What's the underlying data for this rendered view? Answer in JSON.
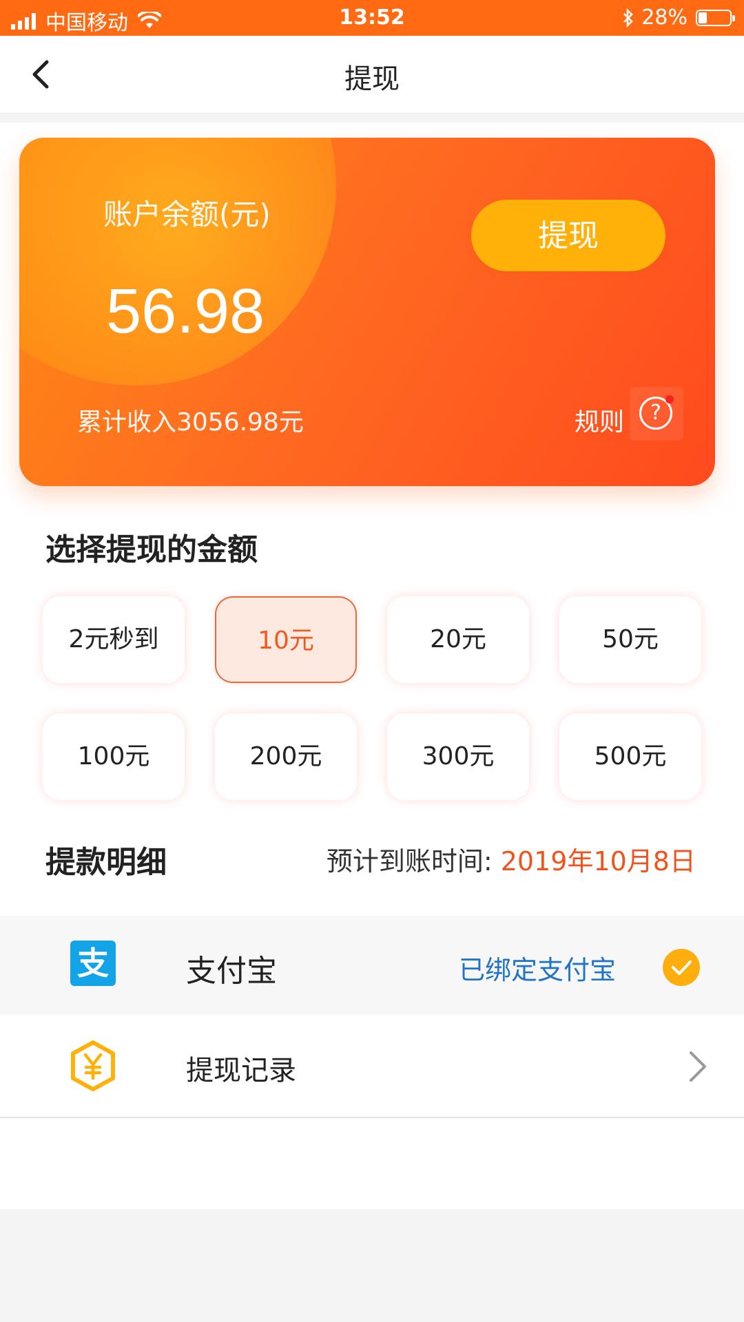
{
  "status_bar": {
    "carrier": "中国移动",
    "time": "13:52",
    "battery": "28%",
    "battery_level": 0.28
  },
  "nav": {
    "title": "提现",
    "back_icon": "chevron-left-icon"
  },
  "balance_card": {
    "label": "账户余额(元)",
    "amount": "56.98",
    "withdraw_button": "提现",
    "income_text": "累计收入3056.98元",
    "rules_label": "规则",
    "rules_icon": "question-circle-icon"
  },
  "amounts": {
    "title": "选择提现的金额",
    "options": [
      "2元秒到",
      "10元",
      "20元",
      "50元",
      "100元",
      "200元",
      "300元",
      "500元"
    ],
    "selected_index": 1
  },
  "details": {
    "title": "提款明细",
    "eta_label": "预计到账时间: ",
    "eta_date": "2019年10月8日"
  },
  "payment": {
    "icon_char": "支",
    "name": "支付宝",
    "status": "已绑定支付宝",
    "check_icon": "check-circle-icon"
  },
  "records": {
    "label": "提现记录",
    "icon": "yen-hexagon-icon",
    "chevron": "chevron-right-icon"
  },
  "colors": {
    "accent": "#ff6a13",
    "button": "#ffb10a",
    "link": "#1f74c8",
    "date": "#f0541e"
  }
}
